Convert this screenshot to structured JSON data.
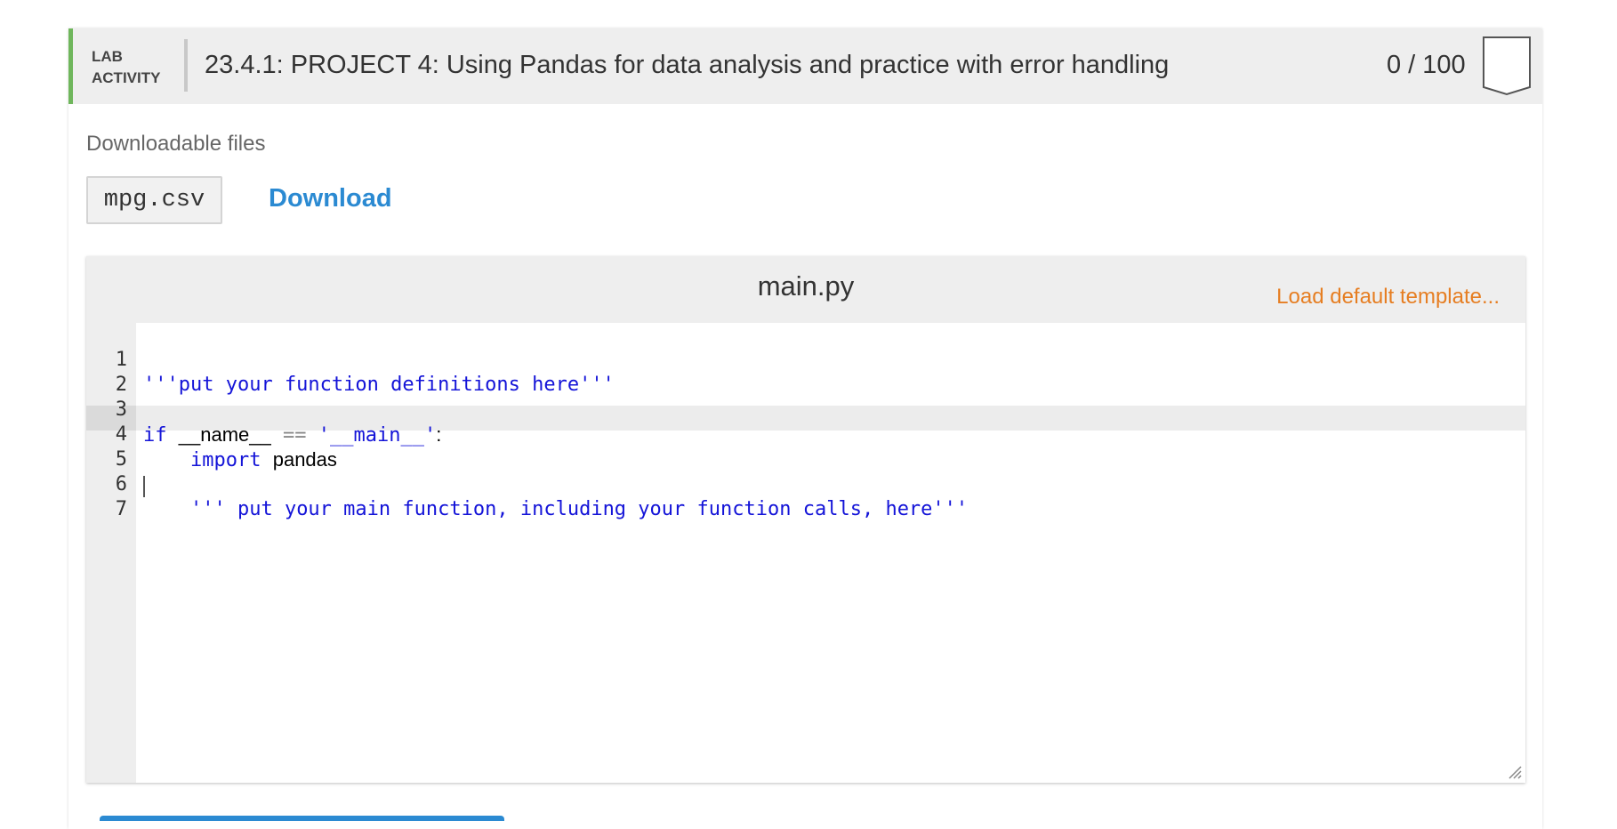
{
  "lab": {
    "tag_line1": "LAB",
    "tag_line2": "ACTIVITY",
    "title": "23.4.1: PROJECT 4: Using Pandas for data analysis and practice with error handling",
    "score": "0 / 100",
    "accent_color": "#6fb65c"
  },
  "downloads": {
    "label": "Downloadable files",
    "file_name": "mpg.csv",
    "download_label": "Download",
    "link_color": "#2b8ad2"
  },
  "editor": {
    "filename": "main.py",
    "template_link": "Load default template...",
    "template_color": "#e67e22",
    "line_numbers": [
      "1",
      "2",
      "3",
      "4",
      "5",
      "6",
      "7"
    ],
    "lines": {
      "l1": "'''put your function definitions here'''",
      "l3_kw": "if",
      "l3_name": "__name__",
      "l3_op": "==",
      "l3_str": "'__main__'",
      "l3_colon": ":",
      "l4_kw": "import",
      "l4_mod": "pandas",
      "l6": "''' put your main function, including your function calls, here'''"
    },
    "active_line": "7"
  },
  "icons": {
    "badge": "completion-badge-icon",
    "resize": "resize-grip-icon"
  }
}
